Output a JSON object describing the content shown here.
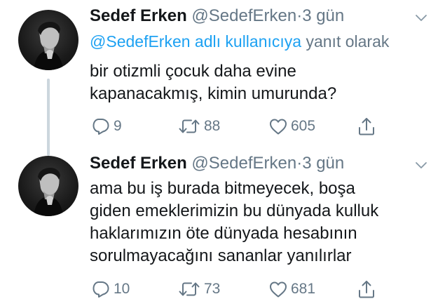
{
  "tweets": [
    {
      "name": "Sedef Erken",
      "handle": "@SedefErken",
      "separator": "·",
      "time": "3 gün",
      "reply_mention": "@SedefErken adlı kullanıcıya",
      "reply_suffix": "yanıt olarak",
      "text_lines": [
        "bir otizmli çocuk daha evine",
        "kapanacakmış, kimin umurunda?"
      ],
      "reply_count": "9",
      "retweet_count": "88",
      "like_count": "605",
      "icons": [
        "reply-icon",
        "retweet-icon",
        "heart-icon",
        "share-icon",
        "chevron-down-icon"
      ]
    },
    {
      "name": "Sedef Erken",
      "handle": "@SedefErken",
      "separator": "·",
      "time": "3 gün",
      "text_lines": [
        "ama bu iş burada bitmeyecek, boşa",
        "giden emeklerimizin bu dünyada kulluk",
        "haklarımızın öte dünyada hesabının",
        "sorulmayacağını sananlar yanılırlar"
      ],
      "reply_count": "10",
      "retweet_count": "73",
      "like_count": "681",
      "icons": [
        "reply-icon",
        "retweet-icon",
        "heart-icon",
        "share-icon",
        "chevron-down-icon"
      ]
    }
  ],
  "colors": {
    "text": "#14171a",
    "muted": "#657786",
    "link": "#1da1f2",
    "thread_line": "#ccd6dd"
  }
}
